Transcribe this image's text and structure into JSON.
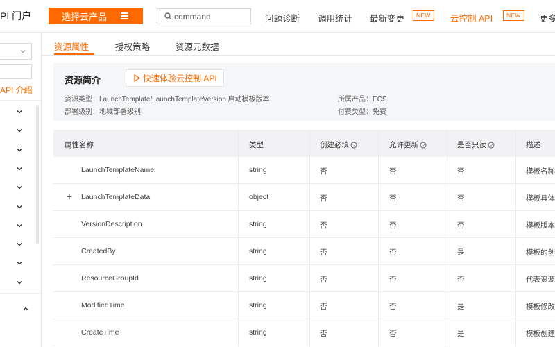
{
  "header": {
    "brand": "PI 门户",
    "select_product": "选择云产品",
    "search_value": "command",
    "nav": [
      {
        "label": "问题诊断"
      },
      {
        "label": "调用统计"
      },
      {
        "label": "最新变更",
        "badge": "NEW"
      },
      {
        "label": "云控制 API",
        "badge": "NEW"
      },
      {
        "label": "更多"
      }
    ]
  },
  "sidebar": {
    "link": "API 介绍",
    "collapsed_items": 10,
    "expanded_items": 1
  },
  "tabs": [
    "资源属性",
    "授权策略",
    "资源元数据"
  ],
  "intro": {
    "title": "资源简介",
    "try_button": "快速体验云控制 API",
    "resource_type_label": "资源类型：",
    "resource_type_value": "LaunchTemplate/LaunchTemplateVersion 启动模板版本",
    "product_label": "所属产品：",
    "product_value": "ECS",
    "deploy_label": "部署级别：",
    "deploy_value": "地域部署级别",
    "pay_label": "付费类型：",
    "pay_value": "免费"
  },
  "table": {
    "headers": [
      "属性名称",
      "类型",
      "创建必填",
      "允许更新",
      "是否只读",
      "描述"
    ],
    "rows": [
      {
        "name": "LaunchTemplateName",
        "type": "string",
        "required": "否",
        "updatable": "否",
        "readonly": "否",
        "desc": "模板名称",
        "expandable": false
      },
      {
        "name": "LaunchTemplateData",
        "type": "object",
        "required": "否",
        "updatable": "否",
        "readonly": "否",
        "desc": "模板具体",
        "expandable": true
      },
      {
        "name": "VersionDescription",
        "type": "string",
        "required": "否",
        "updatable": "否",
        "readonly": "否",
        "desc": "模板版本",
        "expandable": false
      },
      {
        "name": "CreatedBy",
        "type": "string",
        "required": "否",
        "updatable": "否",
        "readonly": "是",
        "desc": "模板的创",
        "expandable": false
      },
      {
        "name": "ResourceGroupId",
        "type": "string",
        "required": "否",
        "updatable": "否",
        "readonly": "否",
        "desc": "代表资源",
        "expandable": false
      },
      {
        "name": "ModifiedTime",
        "type": "string",
        "required": "否",
        "updatable": "否",
        "readonly": "是",
        "desc": "模板修改",
        "expandable": false
      },
      {
        "name": "CreateTime",
        "type": "string",
        "required": "否",
        "updatable": "否",
        "readonly": "是",
        "desc": "模板创建",
        "expandable": false
      }
    ]
  },
  "colors": {
    "accent": "#ff6a00",
    "table_header_bg": "#f2f2f4",
    "card_bg": "#f5f6f8"
  }
}
